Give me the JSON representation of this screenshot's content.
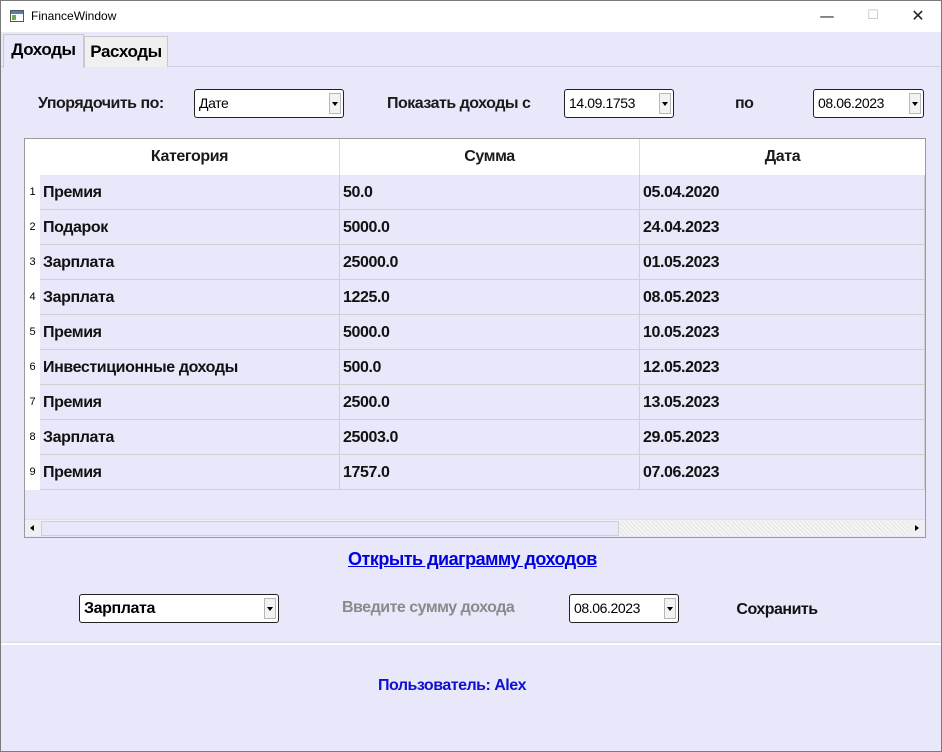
{
  "window": {
    "title": "FinanceWindow",
    "minimize": "—",
    "maximize": "☐",
    "close": "✕"
  },
  "tabs": [
    {
      "label": "Доходы"
    },
    {
      "label": "Расходы"
    }
  ],
  "filters": {
    "sort_label": "Упорядочить по:",
    "sort_value": "Дате",
    "show_label": "Показать доходы с",
    "date_from": "14.09.1753",
    "to_label": "по",
    "date_to": "08.06.2023"
  },
  "table": {
    "columns": [
      "Категория",
      "Сумма",
      "Дата"
    ],
    "rows": [
      {
        "num": "1",
        "category": "Премия",
        "amount": "50.0",
        "date": "05.04.2020"
      },
      {
        "num": "2",
        "category": "Подарок",
        "amount": "5000.0",
        "date": "24.04.2023"
      },
      {
        "num": "3",
        "category": "Зарплата",
        "amount": "25000.0",
        "date": "01.05.2023"
      },
      {
        "num": "4",
        "category": "Зарплата",
        "amount": "1225.0",
        "date": "08.05.2023"
      },
      {
        "num": "5",
        "category": "Премия",
        "amount": "5000.0",
        "date": "10.05.2023"
      },
      {
        "num": "6",
        "category": "Инвестиционные доходы",
        "amount": "500.0",
        "date": "12.05.2023"
      },
      {
        "num": "7",
        "category": "Премия",
        "amount": "2500.0",
        "date": "13.05.2023"
      },
      {
        "num": "8",
        "category": "Зарплата",
        "amount": "25003.0",
        "date": "29.05.2023"
      },
      {
        "num": "9",
        "category": "Премия",
        "amount": "1757.0",
        "date": "07.06.2023"
      }
    ]
  },
  "chart_link": "Открыть диаграмму доходов",
  "form": {
    "category": "Зарплата",
    "amount_placeholder": "Введите сумму дохода",
    "date": "08.06.2023",
    "save": "Сохранить"
  },
  "status": {
    "user": "Пользователь: Alex"
  }
}
